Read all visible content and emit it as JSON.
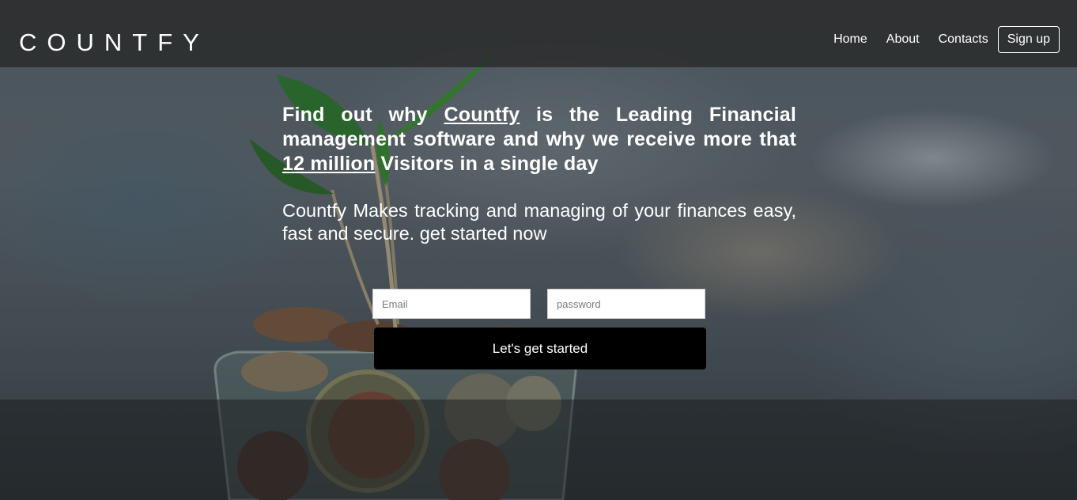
{
  "brand": {
    "name": "COUNTFY"
  },
  "nav": {
    "home": "Home",
    "about": "About",
    "contacts": "Contacts",
    "signup": "Sign up"
  },
  "hero": {
    "headline_part1": "Find out why ",
    "headline_link1": "Countfy",
    "headline_part2": " is the Leading Financial management software and why we receive more that ",
    "headline_link2": "12 million",
    "headline_part3": " Visitors in a single day",
    "subtext": "Countfy Makes tracking and managing of your finances easy, fast and secure. get started now"
  },
  "form": {
    "email_placeholder": "Email",
    "password_placeholder": "password",
    "submit_label": "Let's get started"
  },
  "background": {
    "image": "plant-in-jar-of-coins-photo"
  }
}
